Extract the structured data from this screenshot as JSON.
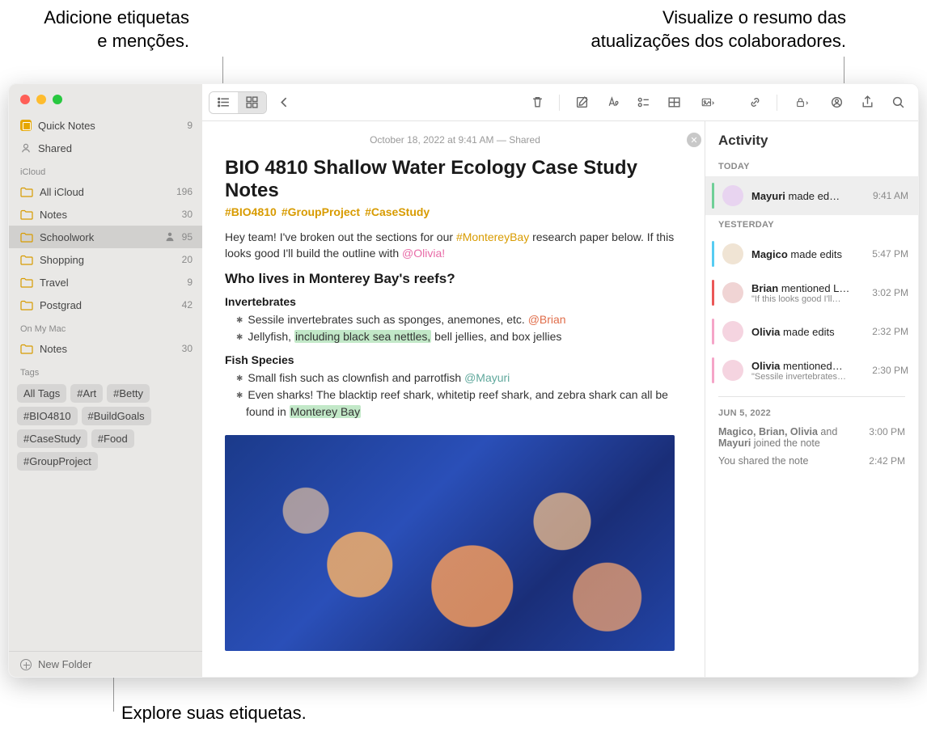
{
  "callouts": {
    "top_left": "Adicione etiquetas\ne menções.",
    "top_right": "Visualize o resumo das\natualizações dos colaboradores.",
    "bottom": "Explore suas etiquetas."
  },
  "sidebar": {
    "quick_notes": {
      "label": "Quick Notes",
      "count": "9"
    },
    "shared": {
      "label": "Shared"
    },
    "section_icloud": "iCloud",
    "icloud_items": [
      {
        "label": "All iCloud",
        "count": "196"
      },
      {
        "label": "Notes",
        "count": "30"
      },
      {
        "label": "Schoolwork",
        "count": "95",
        "selected": true,
        "shared": true
      },
      {
        "label": "Shopping",
        "count": "20"
      },
      {
        "label": "Travel",
        "count": "9"
      },
      {
        "label": "Postgrad",
        "count": "42"
      }
    ],
    "section_onmymac": "On My Mac",
    "onmymac_items": [
      {
        "label": "Notes",
        "count": "30"
      }
    ],
    "section_tags": "Tags",
    "tags": [
      "All Tags",
      "#Art",
      "#Betty",
      "#BIO4810",
      "#BuildGoals",
      "#CaseStudy",
      "#Food",
      "#GroupProject"
    ],
    "new_folder": "New Folder"
  },
  "note": {
    "date": "October 18, 2022 at 9:41 AM — Shared",
    "title": "BIO 4810 Shallow Water Ecology Case Study Notes",
    "tag1": "#BIO4810",
    "tag2": "#GroupProject",
    "tag3": "#CaseStudy",
    "para_pre": "Hey team! I've broken out the sections for our ",
    "para_hash": "#MontereyBay",
    "para_mid": " research paper below. If this looks good I'll build the outline with ",
    "para_mention": "@Olivia!",
    "h2": "Who lives in Monterey Bay's reefs?",
    "h3a": "Invertebrates",
    "b1_pre": "Sessile invertebrates such as sponges, anemones, etc. ",
    "b1_mention": "@Brian",
    "b2_pre": "Jellyfish, ",
    "b2_hl": "including black sea nettles,",
    "b2_post": " bell jellies, and box jellies",
    "h3b": "Fish Species",
    "b3_pre": "Small fish such as clownfish and parrotfish ",
    "b3_mention": "@Mayuri",
    "b4_pre": "Even sharks! The blacktip reef shark, whitetip reef shark, and zebra shark can all be found in ",
    "b4_hl": "Monterey Bay"
  },
  "activity": {
    "title": "Activity",
    "today": "TODAY",
    "yesterday": "YESTERDAY",
    "date3": "JUN 5, 2022",
    "rows": [
      {
        "bar": "#6fcf97",
        "name": "Mayuri",
        "rest": " made ed…",
        "time": "9:41 AM",
        "selected": true,
        "av": "#e8d4f0"
      },
      {
        "bar": "#56ccf2",
        "name": "Magico",
        "rest": " made edits",
        "time": "5:47 PM",
        "av": "#f0e4d4"
      },
      {
        "bar": "#eb5757",
        "name": "Brian",
        "rest": " mentioned L…",
        "sub": "\"If this looks good I'll…",
        "time": "3:02 PM",
        "av": "#f0d4d4"
      },
      {
        "bar": "#f5a5c8",
        "name": "Olivia",
        "rest": " made edits",
        "time": "2:32 PM",
        "av": "#f5d4e0"
      },
      {
        "bar": "#f5a5c8",
        "name": "Olivia",
        "rest": " mentioned…",
        "sub": "\"Sessile invertebrates…",
        "time": "2:30 PM",
        "av": "#f5d4e0"
      }
    ],
    "join_pre": "Magico, Brian, Olivia",
    "join_mid": " and ",
    "join_name": "Mayuri",
    "join_post": " joined the note",
    "join_time": "3:00 PM",
    "shared_text": "You shared the note",
    "shared_time": "2:42 PM"
  }
}
